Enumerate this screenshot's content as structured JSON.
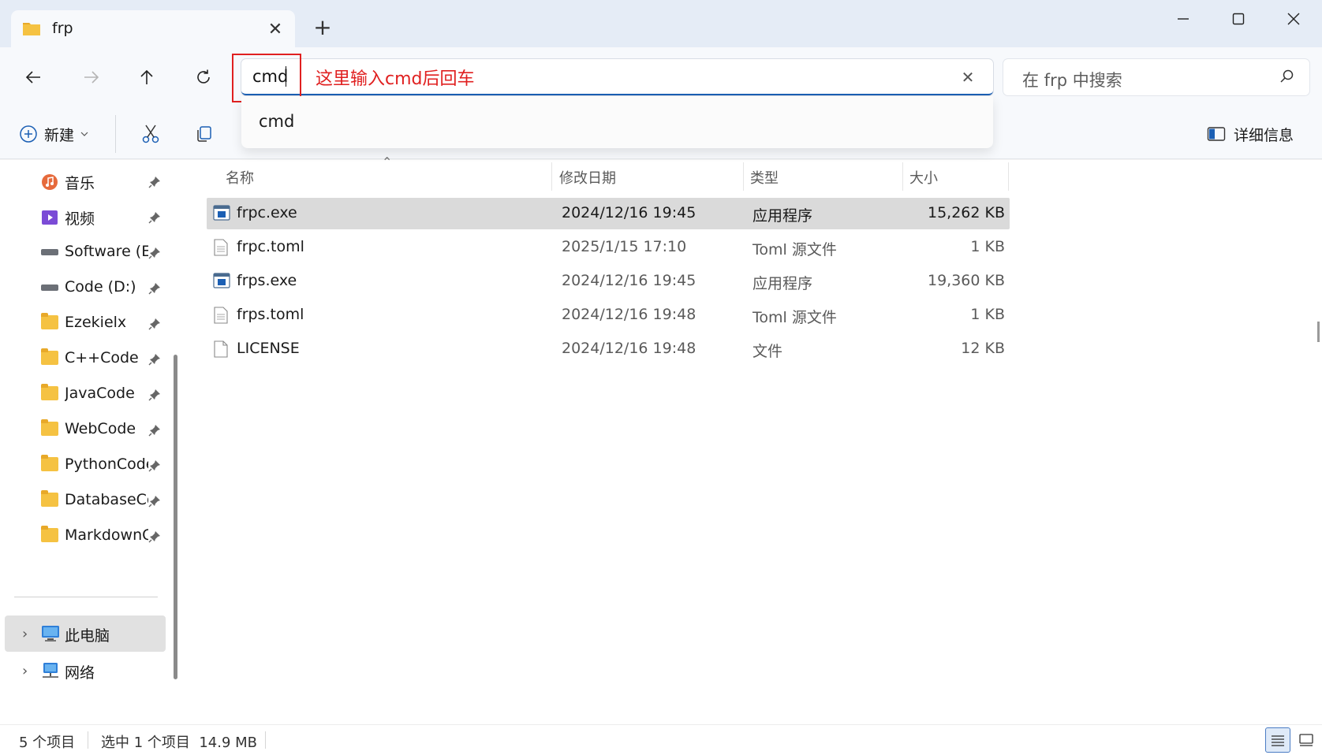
{
  "tab": {
    "title": "frp",
    "close_glyph": "✕",
    "new_tab_glyph": "+"
  },
  "address": {
    "value": "cmd",
    "annotation": "这里输入cmd后回车",
    "clear_glyph": "✕"
  },
  "suggestions": [
    "cmd"
  ],
  "search": {
    "placeholder": "在 frp 中搜索"
  },
  "toolbar": {
    "new_label": "新建",
    "details_label": "详细信息"
  },
  "sidebar": {
    "items": [
      {
        "label": "音乐",
        "icon": "music-icon",
        "pinned": true
      },
      {
        "label": "视频",
        "icon": "video-icon",
        "pinned": true
      },
      {
        "label": "Software (E:)",
        "icon": "drive-icon",
        "pinned": true
      },
      {
        "label": "Code (D:)",
        "icon": "drive-icon",
        "pinned": true
      },
      {
        "label": "Ezekielx",
        "icon": "folder-icon",
        "pinned": true
      },
      {
        "label": "C++Code",
        "icon": "folder-icon",
        "pinned": true
      },
      {
        "label": "JavaCode",
        "icon": "folder-icon",
        "pinned": true
      },
      {
        "label": "WebCode",
        "icon": "folder-icon",
        "pinned": true
      },
      {
        "label": "PythonCode",
        "icon": "folder-icon",
        "pinned": true
      },
      {
        "label": "DatabaseCode",
        "icon": "folder-icon",
        "pinned": true
      },
      {
        "label": "MarkdownCode",
        "icon": "folder-icon",
        "pinned": true
      }
    ],
    "this_pc": "此电脑",
    "network": "网络",
    "chevron_glyph": "›"
  },
  "columns": {
    "name": "名称",
    "modified": "修改日期",
    "type": "类型",
    "size": "大小",
    "sort_glyph": "⌃"
  },
  "files": [
    {
      "name": "frpc.exe",
      "modified": "2024/12/16 19:45",
      "type": "应用程序",
      "size": "15,262 KB",
      "icon": "exe-icon",
      "selected": true
    },
    {
      "name": "frpc.toml",
      "modified": "2025/1/15 17:10",
      "type": "Toml 源文件",
      "size": "1 KB",
      "icon": "text-file-icon",
      "selected": false
    },
    {
      "name": "frps.exe",
      "modified": "2024/12/16 19:45",
      "type": "应用程序",
      "size": "19,360 KB",
      "icon": "exe-icon",
      "selected": false
    },
    {
      "name": "frps.toml",
      "modified": "2024/12/16 19:48",
      "type": "Toml 源文件",
      "size": "1 KB",
      "icon": "text-file-icon",
      "selected": false
    },
    {
      "name": "LICENSE",
      "modified": "2024/12/16 19:48",
      "type": "文件",
      "size": "12 KB",
      "icon": "blank-file-icon",
      "selected": false
    }
  ],
  "status": {
    "count": "5 个项目",
    "selection": "选中 1 个项目  14.9 MB"
  },
  "colors": {
    "accent": "#1b5fb4",
    "annotation": "#e02020",
    "selected_row": "#dadada",
    "folder": "#f5c242"
  }
}
